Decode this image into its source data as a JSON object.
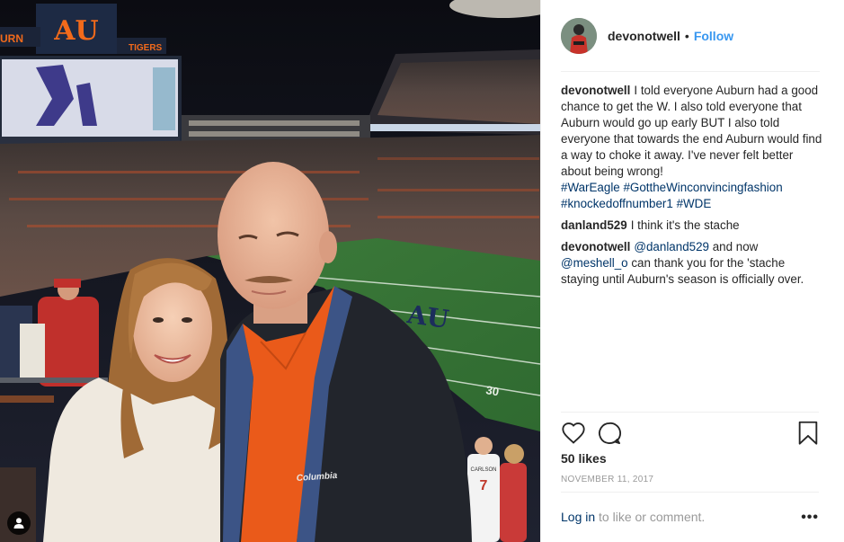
{
  "post": {
    "author": "devonotwell",
    "separator": "•",
    "follow_label": "Follow"
  },
  "photo": {
    "scoreboard_left": "URN",
    "scoreboard_right": "TIGERS",
    "scoreboard_logo": "AU",
    "field_yard": "30",
    "field_logo": "AU",
    "jacket_brand": "Columbia",
    "jersey_name": "CARLSON",
    "jersey_number": "7"
  },
  "comments": [
    {
      "user": "devonotwell",
      "text": "I told everyone Auburn had a good chance to get the W. I also told everyone that Auburn would go up early BUT I also told everyone that towards the end Auburn would find a way to choke it away. I've never felt better about being wrong!",
      "tags": [
        "#WarEagle",
        "#GottheWinconvincingfashion",
        "#knockedoffnumber1",
        "#WDE"
      ]
    },
    {
      "user": "danland529",
      "text": "I think it's the stache"
    },
    {
      "user": "devonotwell",
      "mention1": "@danland529",
      "text1": " and now ",
      "mention2": "@meshell_o",
      "text2": " can thank you for the 'stache staying until Auburn's season is officially over."
    }
  ],
  "likes": "50 likes",
  "date": "NOVEMBER 11, 2017",
  "footer": {
    "login_link": "Log in",
    "login_rest": " to like or comment.",
    "more": "•••"
  },
  "icons": [
    "heart-icon",
    "comment-icon",
    "bookmark-icon",
    "tagged-user-icon",
    "more-options-icon"
  ]
}
